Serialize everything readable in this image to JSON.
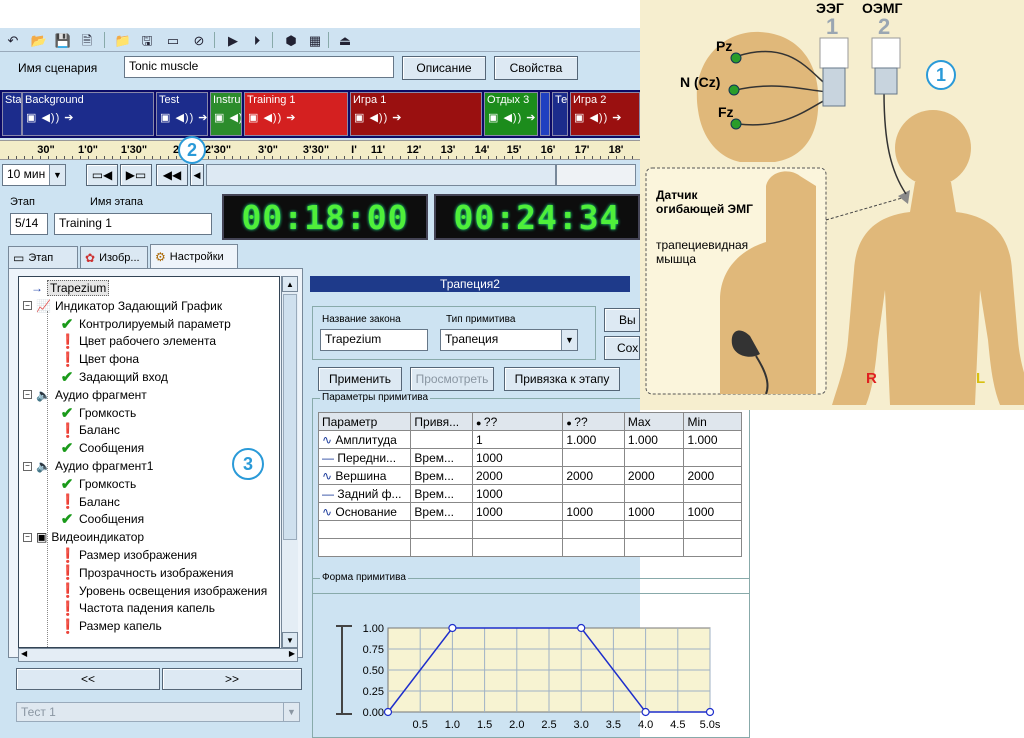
{
  "toolbar": {
    "icons": [
      "undo-icon",
      "open-icon",
      "save-icon",
      "save-as-icon",
      "open-folder-add-icon",
      "save-copy-icon",
      "new-stage-icon",
      "delete-stage-icon",
      "play-stage-icon",
      "play-from-icon",
      "cube-icon",
      "grid-icon",
      "exit-icon"
    ]
  },
  "scenario": {
    "label": "Имя сценария",
    "value": "Tonic muscle",
    "description_btn": "Описание",
    "properties_btn": "Свойства"
  },
  "timeline": {
    "segments": [
      {
        "label": "Sta",
        "color": "#1c2c8c"
      },
      {
        "label": "Background",
        "color": "#1c2c8c"
      },
      {
        "label": "Test",
        "color": "#1c2c8c"
      },
      {
        "label": "Instru",
        "color": "#2c8c2c"
      },
      {
        "label": "Training 1",
        "color": "#d42020"
      },
      {
        "label": "Игра 1",
        "color": "#9a1010"
      },
      {
        "label": "Отдых 3",
        "color": "#1c8c1c"
      },
      {
        "label": "",
        "color": "#2040c0"
      },
      {
        "label": "Те",
        "color": "#1c2c8c"
      },
      {
        "label": "Игра 2",
        "color": "#9a1010"
      }
    ]
  },
  "ruler": {
    "ticks": [
      "30\"",
      "1'0\"",
      "1'30\"",
      "2",
      "2'30\"",
      "3'0\"",
      "3'30\"",
      "I'",
      "11'",
      "12'",
      "13'",
      "14'",
      "15'",
      "16'",
      "17'",
      "18'"
    ]
  },
  "time_select": {
    "value": "10 мин"
  },
  "stage": {
    "label": "Этап",
    "value": "5/14",
    "name_label": "Имя этапа",
    "name_value": "Training 1"
  },
  "timers": {
    "current": "00:18:00",
    "total": "00:24:34"
  },
  "tabs": [
    {
      "label": "Этап",
      "icon": "stage-tab-icon"
    },
    {
      "label": "Изобр...",
      "icon": "image-tab-icon"
    },
    {
      "label": "Настройки",
      "icon": "settings-tab-icon"
    }
  ],
  "tree": {
    "items": [
      {
        "label": "Trapezium",
        "level": 1,
        "icon": "arrow",
        "selected": true
      },
      {
        "label": "Индикатор Задающий График",
        "level": 0,
        "icon": "graph"
      },
      {
        "label": "Контролируемый параметр",
        "level": 2,
        "icon": "check"
      },
      {
        "label": "Цвет рабочего элемента",
        "level": 2,
        "icon": "excl"
      },
      {
        "label": "Цвет фона",
        "level": 2,
        "icon": "excl"
      },
      {
        "label": "Задающий вход",
        "level": 2,
        "icon": "check"
      },
      {
        "label": "Аудио фрагмент",
        "level": 0,
        "icon": "audio"
      },
      {
        "label": "Громкость",
        "level": 2,
        "icon": "check"
      },
      {
        "label": "Баланс",
        "level": 2,
        "icon": "excl"
      },
      {
        "label": "Сообщения",
        "level": 2,
        "icon": "check"
      },
      {
        "label": "Аудио фрагмент1",
        "level": 0,
        "icon": "audio"
      },
      {
        "label": "Громкость",
        "level": 2,
        "icon": "check"
      },
      {
        "label": "Баланс",
        "level": 2,
        "icon": "excl"
      },
      {
        "label": "Сообщения",
        "level": 2,
        "icon": "check"
      },
      {
        "label": "Видеоиндикатор",
        "level": 0,
        "icon": "video"
      },
      {
        "label": "Размер изображения",
        "level": 2,
        "icon": "excl"
      },
      {
        "label": "Прозрачность изображения",
        "level": 2,
        "icon": "excl"
      },
      {
        "label": "Уровень освещения изображения",
        "level": 2,
        "icon": "excl"
      },
      {
        "label": "Частота падения капель",
        "level": 2,
        "icon": "excl"
      },
      {
        "label": "Размер капель",
        "level": 2,
        "icon": "excl"
      }
    ]
  },
  "nav": {
    "prev": "<<",
    "next": ">>"
  },
  "test_select": {
    "value": "Тест 1"
  },
  "panel": {
    "title": "Трапеция2",
    "law_label": "Название закона",
    "law_value": "Trapezium",
    "prim_label": "Тип примитива",
    "prim_value": "Трапеция",
    "side_btn1": "Вы",
    "side_btn2": "Сох",
    "apply": "Применить",
    "preview": "Просмотреть",
    "bind": "Привязка к этапу"
  },
  "params": {
    "group_label": "Параметры примитива",
    "headers": [
      "Параметр",
      "Привя...",
      "??",
      "??",
      "Max",
      "Min"
    ],
    "rows": [
      {
        "name": "Амплитуда",
        "icon": "wave",
        "bind": "",
        "v1": "1",
        "v2": "1.000",
        "max": "1.000",
        "min": "1.000"
      },
      {
        "name": "Передни...",
        "icon": "line",
        "bind": "Врем...",
        "v1": "1000",
        "v2": "",
        "max": "",
        "min": ""
      },
      {
        "name": "Вершина",
        "icon": "wave",
        "bind": "Врем...",
        "v1": "2000",
        "v2": "2000",
        "max": "2000",
        "min": "2000"
      },
      {
        "name": "Задний ф...",
        "icon": "line",
        "bind": "Врем...",
        "v1": "1000",
        "v2": "",
        "max": "",
        "min": ""
      },
      {
        "name": "Основание",
        "icon": "wave",
        "bind": "Врем...",
        "v1": "1000",
        "v2": "1000",
        "max": "1000",
        "min": "1000"
      }
    ]
  },
  "shape": {
    "group_label": "Форма примитива"
  },
  "chart_data": {
    "type": "line",
    "title": "",
    "xlabel": "",
    "ylabel": "",
    "x": [
      0,
      1.0,
      3.0,
      4.0,
      5.0
    ],
    "y": [
      0,
      1.0,
      1.0,
      0,
      0
    ],
    "xlim": [
      0,
      5.0
    ],
    "ylim": [
      0,
      1.0
    ],
    "xticks": [
      "0.5",
      "1.0",
      "1.5",
      "2.0",
      "2.5",
      "3.0",
      "3.5",
      "4.0",
      "4.5",
      "5.0s"
    ],
    "yticks": [
      "0.00",
      "0.25",
      "0.50",
      "0.75",
      "1.00"
    ],
    "grid": true
  },
  "overlay": {
    "eeg_label": "ЭЭГ",
    "eeg_num": "1",
    "emg_label": "ОЭМГ",
    "emg_num": "2",
    "pz": "Pz",
    "ncz": "N (Cz)",
    "fz": "Fz",
    "sensor_title": "Датчик огибающей ЭМГ",
    "muscle": "трапециевидная мышца",
    "right": "R",
    "left": "L",
    "badge1": "1"
  },
  "badges": {
    "b2": "2",
    "b3": "3"
  },
  "colors": {
    "lcd": "#4fef3a",
    "eeg_electrode": "#2a9d2a",
    "badge": "#2a9ad8",
    "R": "#e02020",
    "L": "#d8c010"
  }
}
